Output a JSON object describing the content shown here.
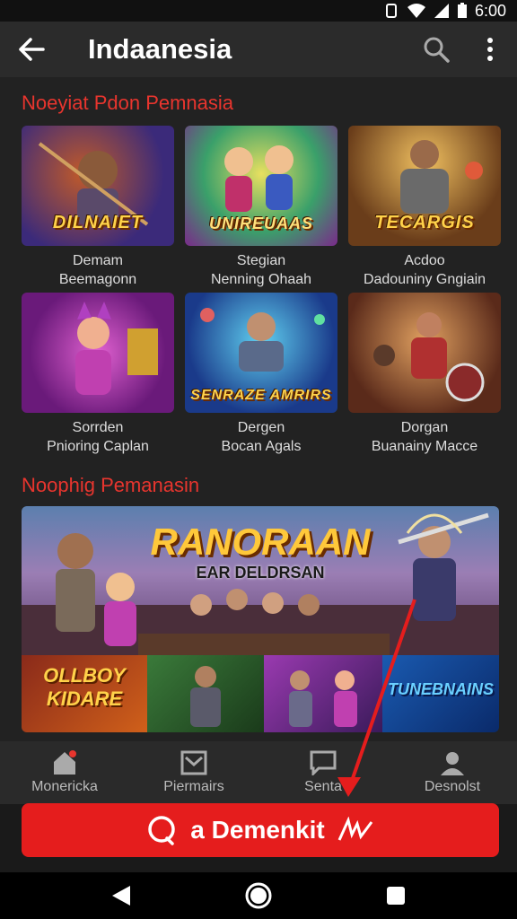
{
  "status": {
    "time": "6:00"
  },
  "appbar": {
    "title": "Indaanesia"
  },
  "section1": {
    "title": "Noeyiat Pdon Pemnasia",
    "cards": [
      {
        "logo": "DILNAIET",
        "line1": "Demam",
        "line2": "Beemagonn",
        "bg1": "#3b2a7a",
        "bg2": "#c05a2a"
      },
      {
        "logo": "UNIREUAAS",
        "line1": "Stegian",
        "line2": "Nenning Ohaah",
        "bg1": "#3aa06a",
        "bg2": "#d08cc8"
      },
      {
        "logo": "TECARGIS",
        "line1": "Acdoo",
        "line2": "Dadouniny Gngiain",
        "bg1": "#6a3d1a",
        "bg2": "#e0a040"
      },
      {
        "logo": "",
        "line1": "Sorrden",
        "line2": "Pnioring Caplan",
        "bg1": "#6a1a7a",
        "bg2": "#c040b0"
      },
      {
        "logo": "SENRAZE AMRIRS",
        "line1": "Dergen",
        "line2": "Bocan Agals",
        "bg1": "#1a3a8a",
        "bg2": "#40a0e0"
      },
      {
        "logo": "",
        "line1": "Dorgan",
        "line2": "Buanainy Macce",
        "bg1": "#5a2a1a",
        "bg2": "#d08040"
      }
    ]
  },
  "section2": {
    "title": "Noophig Pemanasin",
    "banner_title": "RANORAAN",
    "banner_sub": "EAR DELDRSAN",
    "strip_left": "OLLBOY KIDARE",
    "strip_right": "TUNEBNAINS"
  },
  "bottomnav": [
    {
      "label": "Monericka",
      "icon": "home-icon"
    },
    {
      "label": "Piermairs",
      "icon": "inbox-icon"
    },
    {
      "label": "Senta",
      "icon": "chat-icon"
    },
    {
      "label": "Desnolst",
      "icon": "profile-icon"
    }
  ],
  "cta": {
    "label": "a Demenkit"
  },
  "colors": {
    "accent": "#e8352e",
    "cta": "#e51d1d",
    "appbar": "#2b2b2b"
  }
}
